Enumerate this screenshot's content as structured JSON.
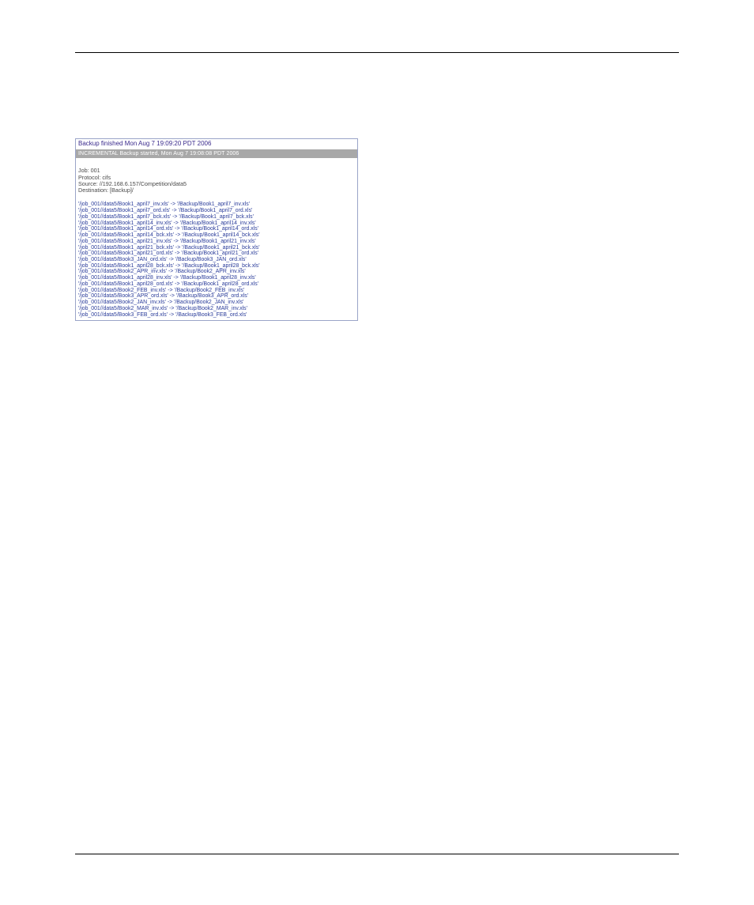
{
  "backup": {
    "finished_line": "Backup finished Mon Aug 7 19:09:20 PDT 2006",
    "started_line": "INCREMENTAL Backup started,  Mon Aug 7 19:08:08 PDT 2006",
    "meta": {
      "job": "Job: 001",
      "protocol": "Protocol: cifs",
      "source": "Source: //192.168.6.157/Competition/data5",
      "destination": "Destination: [Backup]/"
    },
    "rows": [
      {
        "src": "'/job_001//data5/Book1_april7_inv.xls' ->",
        "dst": "'/Backup/Book1_april7_inv.xls'"
      },
      {
        "src": "'/job_001//data5/Book1_april7_ord.xls' ->",
        "dst": "'/Backup/Book1_april7_ord.xls'"
      },
      {
        "src": "'/job_001//data5/Book1_april7_bck.xls' ->",
        "dst": "'/Backup/Book1_april7_bck.xls'"
      },
      {
        "src": "'/job_001//data5/Book1_april14_inv.xls' ->",
        "dst": "'/Backup/Book1_april14_inv.xls'"
      },
      {
        "src": "'/job_001//data5/Book1_april14_ord.xls' ->",
        "dst": "'/Backup/Book1_april14_ord.xls'"
      },
      {
        "src": "'/job_001//data5/Book1_april14_bck.xls' ->",
        "dst": "'/Backup/Book1_april14_bck.xls'"
      },
      {
        "src": "'/job_001//data5/Book1_april21_inv.xls' ->",
        "dst": "'/Backup/Book1_april21_inv.xls'"
      },
      {
        "src": "'/job_001//data5/Book1_april21_bck.xls' ->",
        "dst": "'/Backup/Book1_april21_bck.xls'"
      },
      {
        "src": "'/job_001//data5/Book1_april21_ord.xls' ->",
        "dst": "'/Backup/Book1_april21_ord.xls'"
      },
      {
        "src": "'/job_001//data5/Book3_JAN_ord.xls' ->",
        "dst": "'/Backup/Book3_JAN_ord.xls'"
      },
      {
        "src": "'/job_001//data5/Book1_april28_bck.xls' ->",
        "dst": "'/Backup/Book1_april28_bck.xls'"
      },
      {
        "src": "'/job_001//data5/Book2_APR_inv.xls' ->",
        "dst": "'/Backup/Book2_APR_inv.xls'"
      },
      {
        "src": "'/job_001//data5/Book1_april28_inv.xls' ->",
        "dst": "'/Backup/Book1_april28_inv.xls'"
      },
      {
        "src": "'/job_001//data5/Book1_april28_ord.xls' ->",
        "dst": "'/Backup/Book1_april28_ord.xls'"
      },
      {
        "src": "'/job_001//data5/Book2_FEB_inv.xls' ->",
        "dst": "'/Backup/Book2_FEB_inv.xls'"
      },
      {
        "src": "'/job_001//data5/Book3_APR_ord.xls' ->",
        "dst": "'/Backup/Book3_APR_ord.xls'"
      },
      {
        "src": "'/job_001//data5/Book2_JAN_inv.xls' ->",
        "dst": "'/Backup/Book2_JAN_inv.xls'"
      },
      {
        "src": "'/job_001//data5/Book2_MAR_inv.xls' ->",
        "dst": "'/Backup/Book2_MAR_inv.xls'"
      },
      {
        "src": "'/job_001//data5/Book3_FEB_ord.xls' ->",
        "dst": "'/Backup/Book3_FEB_ord.xls'"
      }
    ]
  }
}
